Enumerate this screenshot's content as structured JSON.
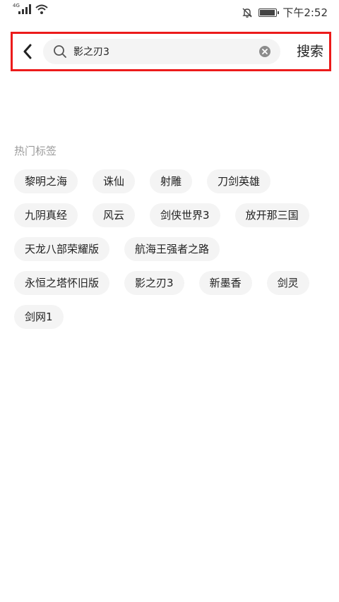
{
  "status_bar": {
    "network": "4G",
    "time": "下午2:52",
    "battery_level": 0.85,
    "icons": [
      "signal-icon",
      "wifi-icon",
      "bell-off-icon",
      "battery-icon"
    ]
  },
  "search": {
    "back_icon": "back-arrow-icon",
    "search_icon": "search-icon",
    "query": "影之刃3",
    "clear_icon": "clear-icon",
    "button_label": "搜索",
    "highlight_color": "#ec1b1b"
  },
  "hot_tags": {
    "title": "热门标签",
    "tags": [
      "黎明之海",
      "诛仙",
      "射雕",
      "刀剑英雄",
      "九阴真经",
      "风云",
      "剑侠世界3",
      "放开那三国",
      "天龙八部荣耀版",
      "航海王强者之路",
      "永恒之塔怀旧版",
      "影之刃3",
      "新墨香",
      "剑灵",
      "剑网1"
    ]
  }
}
